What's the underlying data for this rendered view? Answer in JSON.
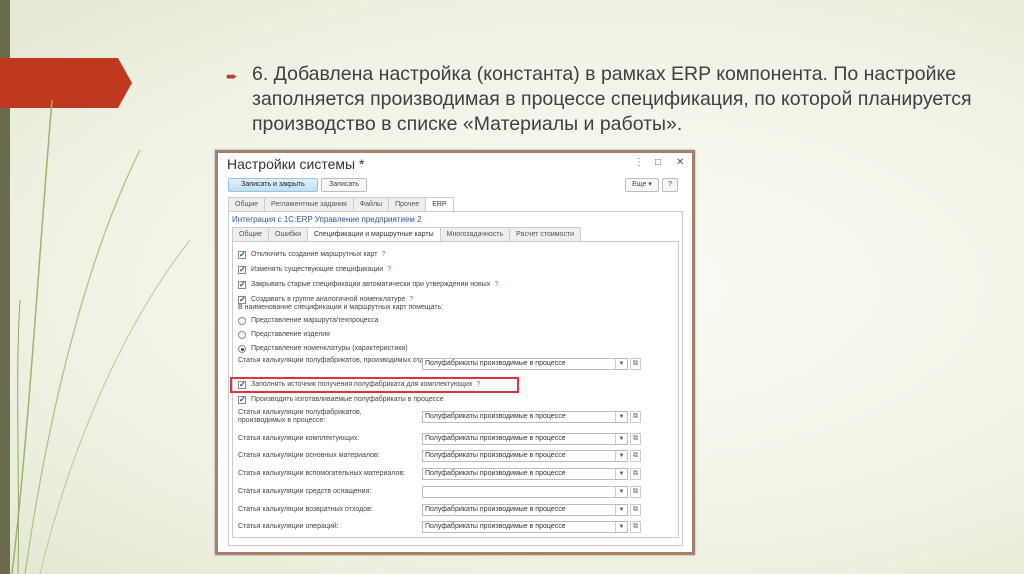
{
  "slide": {
    "bullet_icon": "arrow-bullet-icon",
    "text": "6. Добавлена настройка (константа) в рамках ERP компонента. По настройке заполняется производимая в процессе спецификация, по которой планируется производство в списке «Материалы и работы»."
  },
  "window": {
    "title": "Настройки системы *",
    "buttons": {
      "save_close": "Записать и закрыть",
      "save": "Записать",
      "more": "Еще",
      "help": "?"
    },
    "tabs": [
      "Общие",
      "Регламентные задания",
      "Файлы",
      "Прочее",
      "ERP"
    ],
    "integration_title": "Интеграция с 1С:ERP Управление предприятием 2",
    "subtabs": [
      "Общие",
      "Ошибки",
      "Спецификации и маршрутные карты",
      "Многозадачность",
      "Расчет стоимости"
    ],
    "checkboxes": [
      {
        "label": "Отключить создание маршрутных карт",
        "checked": true
      },
      {
        "label": "Изменять существующие спецификации",
        "checked": true
      },
      {
        "label": "Закрывать старые спецификации автоматически при утверждении новых",
        "checked": true
      },
      {
        "label": "Создавать в группе аналогичной номенклатуре",
        "checked": true
      }
    ],
    "naming_label": "В наименование спецификации и маршрутных карт помещать:",
    "radios": [
      {
        "label": "Представление маршрута/техпроцесса",
        "selected": false
      },
      {
        "label": "Представление изделия",
        "selected": false
      },
      {
        "label": "Представление номенклатуры (характеристики)",
        "selected": true
      }
    ],
    "row_separate": {
      "label": "Статья калькуляции полуфабрикатов, производимых отдельно:",
      "value": "Полуфабрикаты производимые в процессе"
    },
    "highlight_checkbox": {
      "label": "Заполнять источник получения полуфабриката для комплектующих",
      "checked": true
    },
    "produce_checkbox": {
      "label": "Производить изготавливаемые полуфабрикаты в процессе",
      "checked": true
    },
    "rows": [
      {
        "label": "Статья калькуляции полуфабрикатов, производимых в процессе:",
        "value": "Полуфабрикаты производимые в процессе"
      },
      {
        "label": "Статья калькуляции комплектующих:",
        "value": "Полуфабрикаты производимые в процессе"
      },
      {
        "label": "Статья калькуляции основных материалов:",
        "value": "Полуфабрикаты производимые в процессе"
      },
      {
        "label": "Статья калькуляции вспомогательных материалов:",
        "value": "Полуфабрикаты производимые в процессе"
      },
      {
        "label": "Статья калькуляции средств оснащения:",
        "value": ""
      },
      {
        "label": "Статья калькуляции возвратных отходов:",
        "value": "Полуфабрикаты производимые в процессе"
      },
      {
        "label": "Статья калькуляции операций:",
        "value": "Полуфабрикаты производимые в процессе"
      }
    ]
  },
  "colors": {
    "banner": "#c0391f",
    "highlight": "#d9363e",
    "frame": "#a5806a"
  }
}
